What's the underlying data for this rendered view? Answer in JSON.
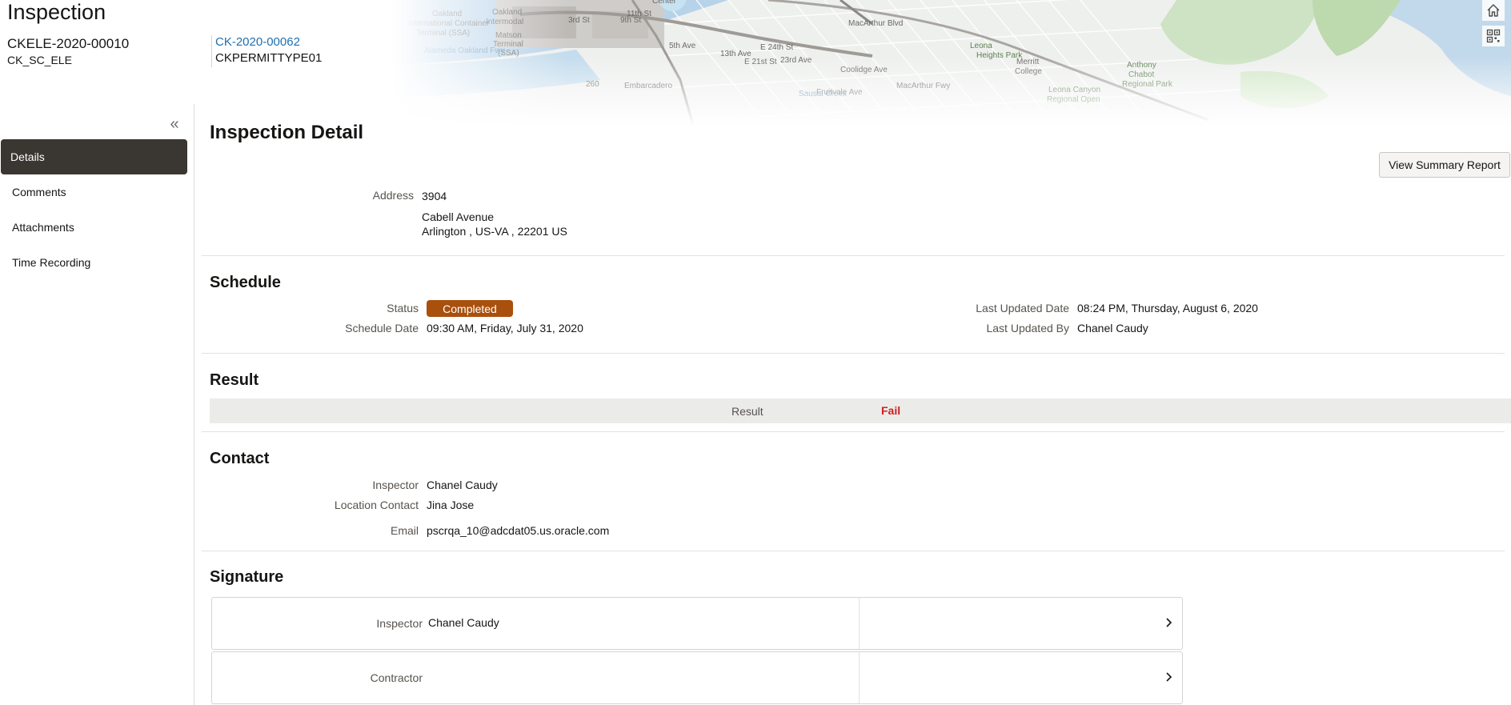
{
  "header": {
    "title": "Inspection",
    "record_id": "CKELE-2020-00010",
    "record_type": "CK_SC_ELE",
    "parent_link": "CK-2020-00062",
    "parent_type": "CKPERMITTYPE01",
    "map_labels": [
      "Oakland International Container Terminal (SSA)",
      "Oakland Intermodal",
      "Matson Terminal (SSA)",
      "Alameda Oakland Fwy",
      "3rd St",
      "9th St",
      "11th St",
      "5th Ave",
      "13th Ave",
      "E 21st St",
      "E 24th St",
      "23rd Ave",
      "Sausal Creek",
      "Fruitvale Ave",
      "Coolidge Ave",
      "MacArthur Blvd",
      "MacArthur Fwy",
      "Leona Heights Park",
      "Merritt College",
      "Anthony Chabot Regional Park",
      "Leona Canyon Regional Open",
      "Embarcadero",
      "Center",
      "260"
    ],
    "icons": {
      "home": "home-icon",
      "qr": "qr-code-icon"
    }
  },
  "nav": {
    "collapse_glyph": "«",
    "items": [
      {
        "label": "Details",
        "active": true
      },
      {
        "label": "Comments",
        "active": false
      },
      {
        "label": "Attachments",
        "active": false
      },
      {
        "label": "Time Recording",
        "active": false
      }
    ]
  },
  "detail": {
    "title": "Inspection Detail",
    "summary_button": "View Summary Report",
    "address_label": "Address",
    "address_line1": "3904",
    "address_line2": "Cabell Avenue",
    "address_line3": "Arlington , US-VA , 22201 US"
  },
  "schedule": {
    "title": "Schedule",
    "status_label": "Status",
    "status_value": "Completed",
    "schedule_date_label": "Schedule Date",
    "schedule_date_value": "09:30 AM, Friday, July 31, 2020",
    "last_updated_date_label": "Last Updated Date",
    "last_updated_date_value": "08:24 PM, Thursday, August 6, 2020",
    "last_updated_by_label": "Last Updated By",
    "last_updated_by_value": "Chanel Caudy"
  },
  "result": {
    "title": "Result",
    "result_label": "Result",
    "result_value": "Fail"
  },
  "contact": {
    "title": "Contact",
    "inspector_label": "Inspector",
    "inspector_value": "Chanel Caudy",
    "location_contact_label": "Location Contact",
    "location_contact_value": "Jina Jose",
    "email_label": "Email",
    "email_value": "pscrqa_10@adcdat05.us.oracle.com"
  },
  "signature": {
    "title": "Signature",
    "cards": [
      {
        "label": "Inspector",
        "value": "Chanel Caudy"
      },
      {
        "label": "Contractor",
        "value": ""
      }
    ]
  },
  "colors": {
    "nav_active_bg": "#3a3632",
    "status_badge_bg": "#a9500d",
    "result_fail": "#d21f1f",
    "link": "#1f6faf"
  }
}
